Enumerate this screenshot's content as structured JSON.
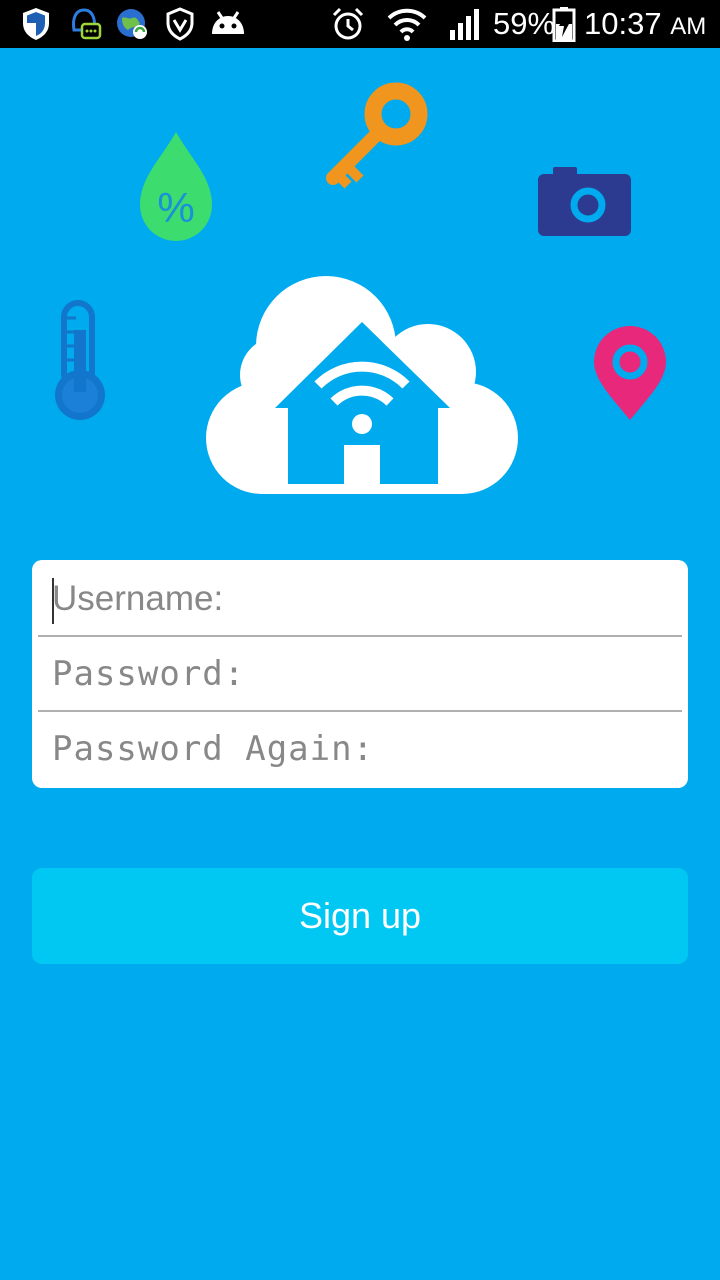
{
  "status_bar": {
    "battery": "59%",
    "time": "10:37",
    "ampm": "AM",
    "icons": [
      "shield-icon",
      "chat-notification-icon",
      "globe-sync-icon",
      "vpn-shield-icon",
      "android-icon",
      "alarm-icon",
      "wifi-icon",
      "signal-icon",
      "battery-charging-icon"
    ]
  },
  "hero": {
    "icons": [
      "humidity-drop-icon",
      "key-icon",
      "camera-icon",
      "thermometer-icon",
      "location-pin-icon",
      "smart-home-cloud-logo"
    ],
    "colors": {
      "drop": "#3ddc6e",
      "key": "#f0961e",
      "camera": "#2c3b8f",
      "thermometer": "#1176cc",
      "pin": "#e8287a",
      "cloud": "#ffffff"
    },
    "drop_symbol": "%"
  },
  "form": {
    "username_placeholder": "Username:",
    "password_placeholder": "Password:",
    "password_again_placeholder": "Password Again:"
  },
  "signup_label": "Sign up",
  "colors": {
    "background": "#00aaee",
    "button": "#00c8f2"
  }
}
